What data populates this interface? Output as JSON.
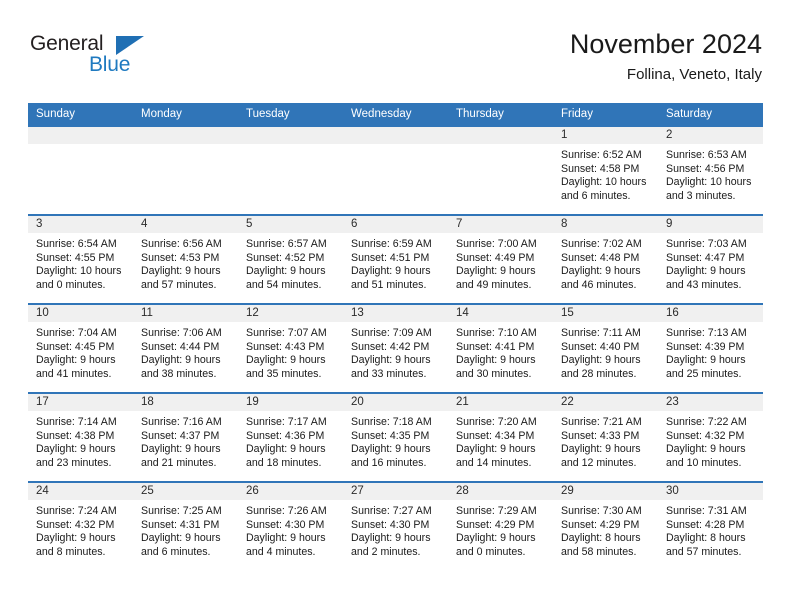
{
  "brand": {
    "name_part1": "General",
    "name_part2": "Blue",
    "triangle_color": "#1f6fb4",
    "blue_color": "#1f7ac0"
  },
  "header": {
    "title": "November 2024",
    "subtitle": "Follina, Veneto, Italy",
    "header_bg": "#3075b8",
    "daynum_bg": "#f0f0f0"
  },
  "weekdays": [
    "Sunday",
    "Monday",
    "Tuesday",
    "Wednesday",
    "Thursday",
    "Friday",
    "Saturday"
  ],
  "labels": {
    "sunrise_prefix": "Sunrise:",
    "sunset_prefix": "Sunset:",
    "daylight_prefix": "Daylight:"
  },
  "weeks": [
    [
      {
        "day": "",
        "empty": true
      },
      {
        "day": "",
        "empty": true
      },
      {
        "day": "",
        "empty": true
      },
      {
        "day": "",
        "empty": true
      },
      {
        "day": "",
        "empty": true
      },
      {
        "day": "1",
        "sunrise": "Sunrise: 6:52 AM",
        "sunset": "Sunset: 4:58 PM",
        "daylight": "Daylight: 10 hours and 6 minutes."
      },
      {
        "day": "2",
        "sunrise": "Sunrise: 6:53 AM",
        "sunset": "Sunset: 4:56 PM",
        "daylight": "Daylight: 10 hours and 3 minutes."
      }
    ],
    [
      {
        "day": "3",
        "sunrise": "Sunrise: 6:54 AM",
        "sunset": "Sunset: 4:55 PM",
        "daylight": "Daylight: 10 hours and 0 minutes."
      },
      {
        "day": "4",
        "sunrise": "Sunrise: 6:56 AM",
        "sunset": "Sunset: 4:53 PM",
        "daylight": "Daylight: 9 hours and 57 minutes."
      },
      {
        "day": "5",
        "sunrise": "Sunrise: 6:57 AM",
        "sunset": "Sunset: 4:52 PM",
        "daylight": "Daylight: 9 hours and 54 minutes."
      },
      {
        "day": "6",
        "sunrise": "Sunrise: 6:59 AM",
        "sunset": "Sunset: 4:51 PM",
        "daylight": "Daylight: 9 hours and 51 minutes."
      },
      {
        "day": "7",
        "sunrise": "Sunrise: 7:00 AM",
        "sunset": "Sunset: 4:49 PM",
        "daylight": "Daylight: 9 hours and 49 minutes."
      },
      {
        "day": "8",
        "sunrise": "Sunrise: 7:02 AM",
        "sunset": "Sunset: 4:48 PM",
        "daylight": "Daylight: 9 hours and 46 minutes."
      },
      {
        "day": "9",
        "sunrise": "Sunrise: 7:03 AM",
        "sunset": "Sunset: 4:47 PM",
        "daylight": "Daylight: 9 hours and 43 minutes."
      }
    ],
    [
      {
        "day": "10",
        "sunrise": "Sunrise: 7:04 AM",
        "sunset": "Sunset: 4:45 PM",
        "daylight": "Daylight: 9 hours and 41 minutes."
      },
      {
        "day": "11",
        "sunrise": "Sunrise: 7:06 AM",
        "sunset": "Sunset: 4:44 PM",
        "daylight": "Daylight: 9 hours and 38 minutes."
      },
      {
        "day": "12",
        "sunrise": "Sunrise: 7:07 AM",
        "sunset": "Sunset: 4:43 PM",
        "daylight": "Daylight: 9 hours and 35 minutes."
      },
      {
        "day": "13",
        "sunrise": "Sunrise: 7:09 AM",
        "sunset": "Sunset: 4:42 PM",
        "daylight": "Daylight: 9 hours and 33 minutes."
      },
      {
        "day": "14",
        "sunrise": "Sunrise: 7:10 AM",
        "sunset": "Sunset: 4:41 PM",
        "daylight": "Daylight: 9 hours and 30 minutes."
      },
      {
        "day": "15",
        "sunrise": "Sunrise: 7:11 AM",
        "sunset": "Sunset: 4:40 PM",
        "daylight": "Daylight: 9 hours and 28 minutes."
      },
      {
        "day": "16",
        "sunrise": "Sunrise: 7:13 AM",
        "sunset": "Sunset: 4:39 PM",
        "daylight": "Daylight: 9 hours and 25 minutes."
      }
    ],
    [
      {
        "day": "17",
        "sunrise": "Sunrise: 7:14 AM",
        "sunset": "Sunset: 4:38 PM",
        "daylight": "Daylight: 9 hours and 23 minutes."
      },
      {
        "day": "18",
        "sunrise": "Sunrise: 7:16 AM",
        "sunset": "Sunset: 4:37 PM",
        "daylight": "Daylight: 9 hours and 21 minutes."
      },
      {
        "day": "19",
        "sunrise": "Sunrise: 7:17 AM",
        "sunset": "Sunset: 4:36 PM",
        "daylight": "Daylight: 9 hours and 18 minutes."
      },
      {
        "day": "20",
        "sunrise": "Sunrise: 7:18 AM",
        "sunset": "Sunset: 4:35 PM",
        "daylight": "Daylight: 9 hours and 16 minutes."
      },
      {
        "day": "21",
        "sunrise": "Sunrise: 7:20 AM",
        "sunset": "Sunset: 4:34 PM",
        "daylight": "Daylight: 9 hours and 14 minutes."
      },
      {
        "day": "22",
        "sunrise": "Sunrise: 7:21 AM",
        "sunset": "Sunset: 4:33 PM",
        "daylight": "Daylight: 9 hours and 12 minutes."
      },
      {
        "day": "23",
        "sunrise": "Sunrise: 7:22 AM",
        "sunset": "Sunset: 4:32 PM",
        "daylight": "Daylight: 9 hours and 10 minutes."
      }
    ],
    [
      {
        "day": "24",
        "sunrise": "Sunrise: 7:24 AM",
        "sunset": "Sunset: 4:32 PM",
        "daylight": "Daylight: 9 hours and 8 minutes."
      },
      {
        "day": "25",
        "sunrise": "Sunrise: 7:25 AM",
        "sunset": "Sunset: 4:31 PM",
        "daylight": "Daylight: 9 hours and 6 minutes."
      },
      {
        "day": "26",
        "sunrise": "Sunrise: 7:26 AM",
        "sunset": "Sunset: 4:30 PM",
        "daylight": "Daylight: 9 hours and 4 minutes."
      },
      {
        "day": "27",
        "sunrise": "Sunrise: 7:27 AM",
        "sunset": "Sunset: 4:30 PM",
        "daylight": "Daylight: 9 hours and 2 minutes."
      },
      {
        "day": "28",
        "sunrise": "Sunrise: 7:29 AM",
        "sunset": "Sunset: 4:29 PM",
        "daylight": "Daylight: 9 hours and 0 minutes."
      },
      {
        "day": "29",
        "sunrise": "Sunrise: 7:30 AM",
        "sunset": "Sunset: 4:29 PM",
        "daylight": "Daylight: 8 hours and 58 minutes."
      },
      {
        "day": "30",
        "sunrise": "Sunrise: 7:31 AM",
        "sunset": "Sunset: 4:28 PM",
        "daylight": "Daylight: 8 hours and 57 minutes."
      }
    ]
  ]
}
